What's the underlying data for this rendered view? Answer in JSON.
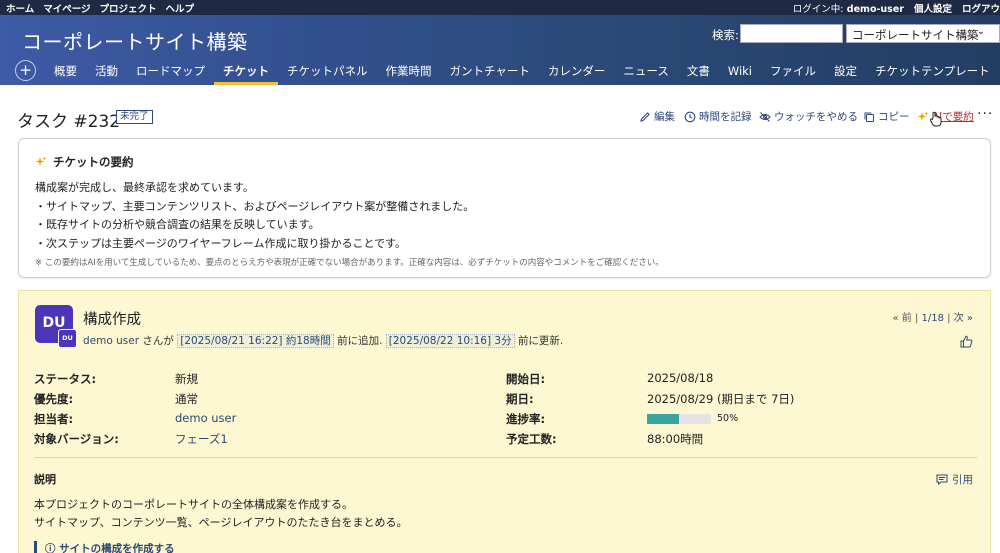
{
  "topbar": {
    "menu": [
      "ホーム",
      "マイページ",
      "プロジェクト",
      "ヘルプ"
    ],
    "login_label": "ログイン中:",
    "login_user": "demo-user",
    "settings": "個人設定",
    "logout": "ログアウ"
  },
  "header": {
    "project_title": "コーポレートサイト構築",
    "search_label": "検索:",
    "search_value": "",
    "project_select": "コーポレートサイト構築"
  },
  "nav": {
    "add": "+",
    "tabs": [
      "概要",
      "活動",
      "ロードマップ",
      "チケット",
      "チケットパネル",
      "作業時間",
      "ガントチャート",
      "カレンダー",
      "ニュース",
      "文書",
      "Wiki",
      "ファイル",
      "設定",
      "チケットテンプレート"
    ],
    "active": "チケット"
  },
  "task": {
    "title": "タスク #232",
    "status_tag": "未完了"
  },
  "actions": {
    "edit": "編集",
    "log_time": "時間を記録",
    "unwatch": "ウォッチをやめる",
    "copy": "コピー",
    "ai_summary": "AIで要約",
    "more": "···"
  },
  "summary": {
    "title": "チケットの要約",
    "intro": "構成案が完成し、最終承認を求めています。",
    "bullets": [
      "・サイトマップ、主要コンテンツリスト、およびページレイアウト案が整備されました。",
      "・既存サイトの分析や競合調査の結果を反映しています。",
      "・次ステップは主要ページのワイヤーフレーム作成に取り掛かることです。"
    ],
    "note": "※ この要約はAIを用いて生成しているため、要点のとらえ方や表現が正確でない場合があります。正確な内容は、必ずチケットの内容やコメントをご確認ください。"
  },
  "issue": {
    "avatar": "DU",
    "avatar_small": "DU",
    "subject": "構成作成",
    "author": "demo user",
    "author_suffix": "さんが",
    "created_stamp": "[2025/08/21 16:22] 約18時間",
    "created_suffix": "前に追加.",
    "updated_stamp": "[2025/08/22 10:16] 3分",
    "updated_suffix": "前に更新.",
    "pager_prev": "« 前",
    "pager_pos": "1/18",
    "pager_next": "次 »",
    "attributes": {
      "status_label": "ステータス:",
      "status": "新規",
      "priority_label": "優先度:",
      "priority": "通常",
      "assignee_label": "担当者:",
      "assignee": "demo user",
      "version_label": "対象バージョン:",
      "version": "フェーズ1",
      "start_label": "開始日:",
      "start": "2025/08/18",
      "due_label": "期日:",
      "due": "2025/08/29 (期日まで 7日)",
      "progress_label": "進捗率:",
      "progress_text": "50%",
      "progress": 50,
      "estimate_label": "予定工数:",
      "estimate": "88:00時間"
    },
    "description_title": "説明",
    "quote": "引用",
    "description": [
      "本プロジェクトのコーポレートサイトの全体構成案を作成する。",
      "サイトマップ、コンテンツ一覧、ページレイアウトのたたき台をまとめる。"
    ],
    "subsection": "サイトの構成を作成する"
  },
  "colors": {
    "header": "#2b4a78",
    "accent": "#f1c232",
    "detail_bg": "#fdf8d2",
    "avatar": "#4b35b8",
    "progress": "#3aa5a0"
  }
}
